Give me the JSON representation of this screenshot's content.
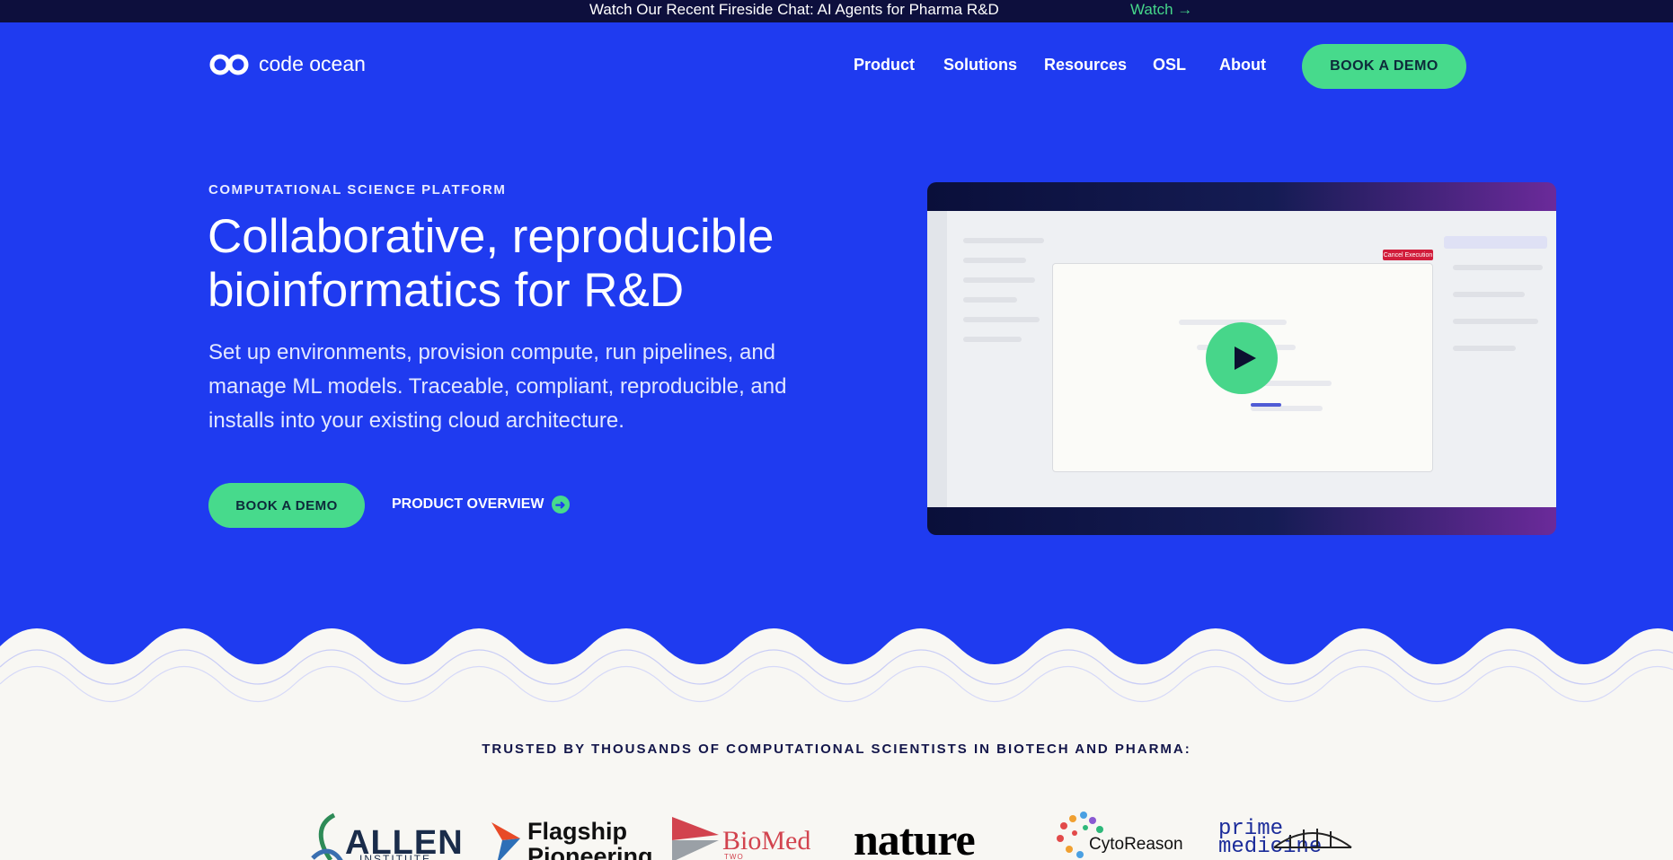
{
  "announcement": {
    "message": "Watch Our Recent Fireside Chat: AI Agents for Pharma R&D",
    "link": "Watch →"
  },
  "brand": {
    "name": "code ocean"
  },
  "nav": {
    "items": [
      "Product",
      "Solutions",
      "Resources",
      "OSL",
      "About"
    ],
    "cta": "BOOK A DEMO"
  },
  "hero": {
    "eyebrow": "COMPUTATIONAL SCIENCE PLATFORM",
    "headline_line1": "Collaborative, reproducible",
    "headline_line2": "bioinformatics for R&D",
    "subtitle_line1": "Set up environments, provision compute, run pipelines, and",
    "subtitle_line2": "manage ML models. Traceable, compliant, reproducible, and",
    "subtitle_line3": "installs into your existing cloud architecture.",
    "cta_primary": "BOOK A DEMO",
    "cta_secondary": "PRODUCT OVERVIEW"
  },
  "video": {
    "badge": "Cancel Execution",
    "play_icon": "play-icon"
  },
  "trusted": {
    "heading": "TRUSTED BY THOUSANDS OF COMPUTATIONAL SCIENTISTS IN BIOTECH AND PHARMA:",
    "logos": {
      "allen": {
        "name": "ALLEN",
        "sub": "INSTITUTE"
      },
      "flagship": {
        "line1": "Flagship",
        "line2": "Pioneering"
      },
      "biomedx": {
        "name": "BioMed X",
        "sub": "TWO WORLDS · ONE INSTITUTE"
      },
      "nature": {
        "name": "nature"
      },
      "cytoreason": {
        "name": "CytoReason"
      },
      "prime": {
        "line1": "prime",
        "line2": "medicine"
      }
    }
  },
  "colors": {
    "hero_bg": "#1f3bf0",
    "accent_green": "#47da8c",
    "topbar_bg": "#0d0f3d",
    "page_bg": "#f8f7f3"
  }
}
